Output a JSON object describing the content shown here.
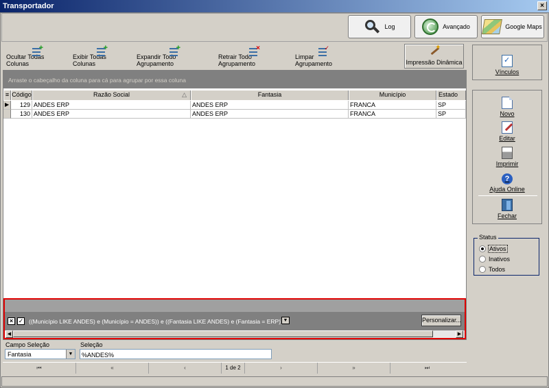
{
  "window": {
    "title": "Transportador",
    "close_glyph": "×"
  },
  "top_buttons": {
    "log": "Log",
    "avancado": "Avançado",
    "google_maps": "Google Maps"
  },
  "toolbar": {
    "ocultar": "Ocultar Todas Colunas",
    "exibir": "Exibir Todas  Colunas",
    "expandir": "Expandir Todo Agrupamento",
    "retrair": "Retrair Todo Agrupamento",
    "limpar": "Limpar Agrupamento",
    "impressao": "Impressão Dinâmica"
  },
  "grid": {
    "group_hint": "Arraste o cabeçalho da coluna para cá para agrupar por essa coluna",
    "columns": [
      "Código",
      "Razão Social",
      "Fantasia",
      "Município",
      "Estado"
    ],
    "sort_glyph": "△",
    "rows": [
      {
        "codigo": "129",
        "razao": "ANDES ERP",
        "fantasia": "ANDES ERP",
        "municipio": "FRANCA",
        "estado": "SP"
      },
      {
        "codigo": "130",
        "razao": "ANDES ERP",
        "fantasia": "ANDES ERP",
        "municipio": "FRANCA",
        "estado": "SP"
      }
    ]
  },
  "filter": {
    "expression": "((Município LIKE ANDES) e (Município = ANDES)) e ((Fantasia LIKE ANDES) e (Fantasia = ERP))",
    "personalizar": "Personalizar...",
    "close_glyph": "×",
    "check_glyph": "✓",
    "dropdown_glyph": "▼"
  },
  "selection": {
    "campo_label": "Campo Seleção",
    "campo_value": "Fantasia",
    "selecao_label": "Seleção",
    "selecao_value": "%ANDES%"
  },
  "pager": {
    "first": "⏮",
    "prev_page": "«",
    "prev": "‹",
    "page_text": "1 de 2",
    "next": "›",
    "next_page": "»",
    "last": "⏭"
  },
  "side": {
    "vinculos": "Vínculos",
    "novo": "Novo",
    "editar": "Editar",
    "imprimir": "Imprimir",
    "ajuda": "Ajuda Online",
    "fechar": "Fechar"
  },
  "status": {
    "legend": "Status",
    "options": [
      "Ativos",
      "Inativos",
      "Todos"
    ],
    "selected": "Ativos"
  }
}
